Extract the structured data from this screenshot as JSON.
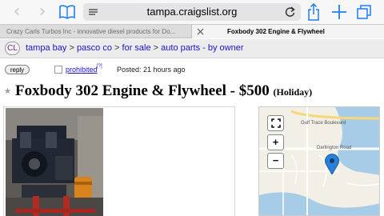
{
  "browser": {
    "url": "tampa.craigslist.org",
    "tabs": [
      {
        "title": "Crazy Carls Turbos Inc - innovative diesel products for Do...",
        "active": false
      },
      {
        "title": "Foxbody 302 Engine & Flywheel",
        "active": true
      }
    ],
    "icons": [
      "back-icon",
      "forward-icon",
      "bookmarks-icon",
      "reader-icon",
      "reload-icon",
      "share-icon",
      "new-tab-icon",
      "tabs-icon",
      "close-icon"
    ]
  },
  "header": {
    "logo": "CL",
    "breadcrumbs": [
      "tampa bay",
      "pasco co",
      "for sale",
      "auto parts - by owner"
    ],
    "separator": ">"
  },
  "post": {
    "reply_label": "reply",
    "prohibited_label": "prohibited",
    "prohibited_help": "[?]",
    "posted": "Posted: 21 hours ago",
    "title": "Foxbody 302 Engine & Flywheel - $500",
    "location": "(Holiday)"
  },
  "map": {
    "labels": {
      "street1": "Gulf Trace Boulevard",
      "street2": "Darlington Road"
    },
    "controls": {
      "fullscreen": "fullscreen-icon",
      "zoom_in": "+",
      "zoom_out": "−"
    },
    "marker_color": "#2a7fd6"
  },
  "colors": {
    "link": "#1a13cc",
    "toolbar": "#f7f7f7",
    "header": "#ececec"
  }
}
